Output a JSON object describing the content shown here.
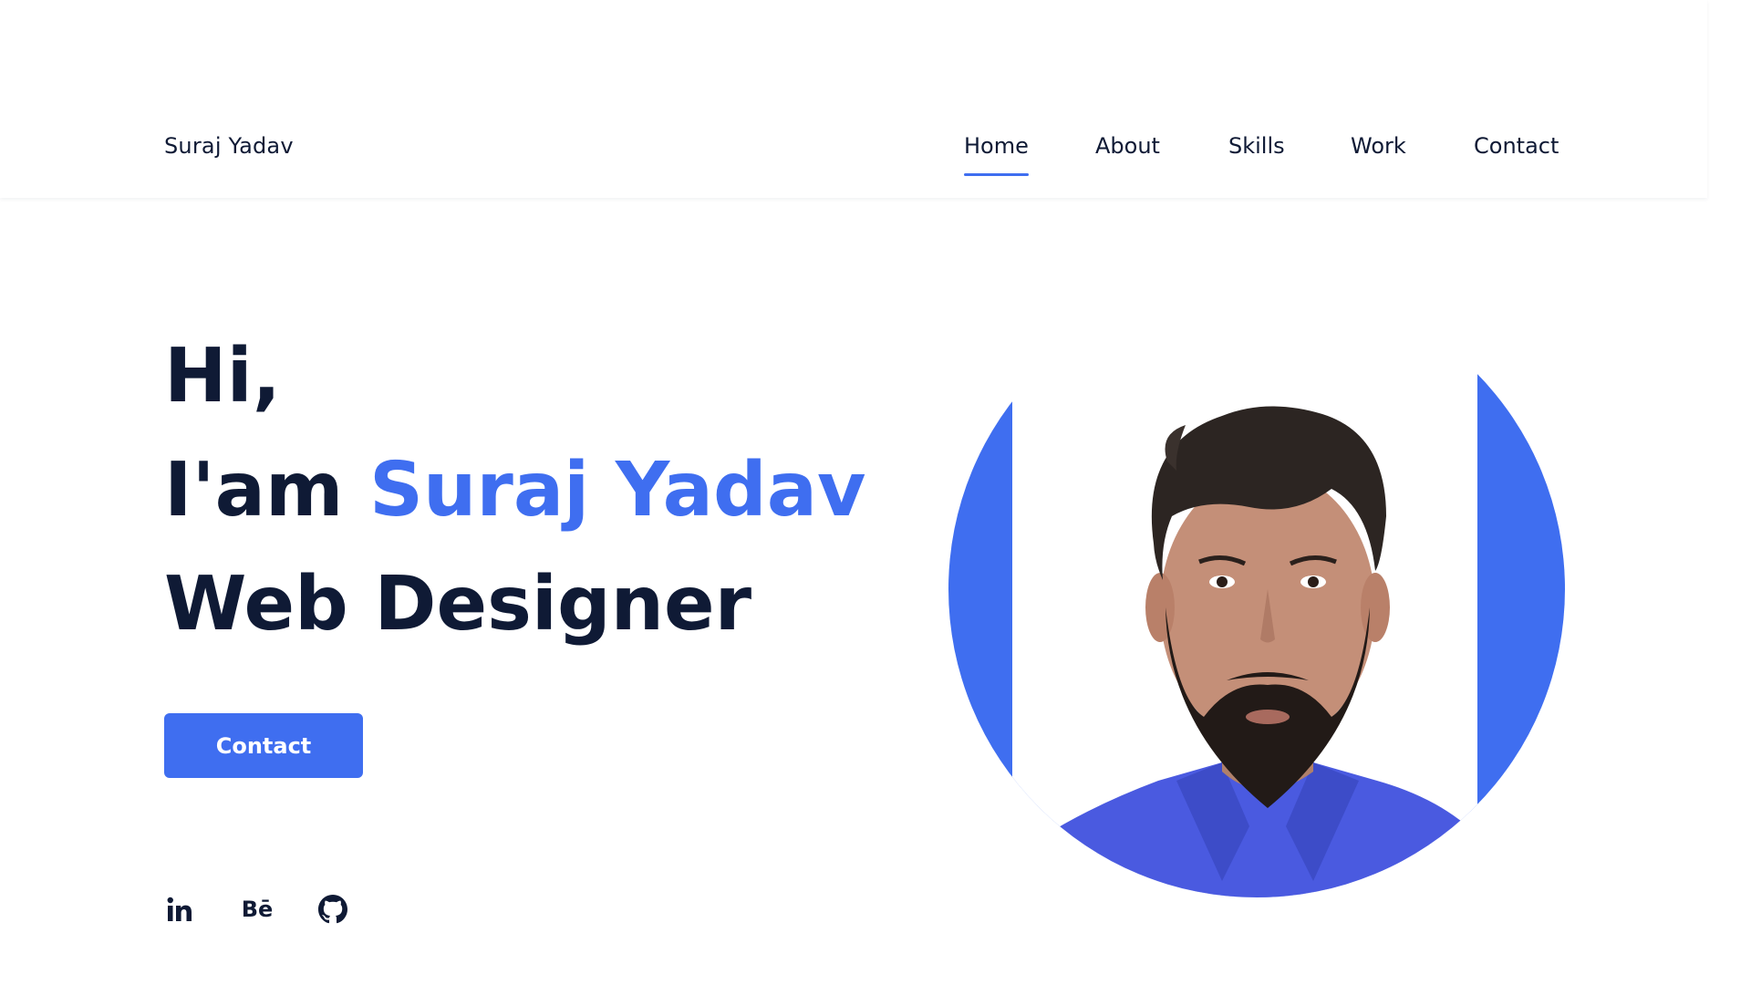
{
  "header": {
    "logo": "Suraj Yadav",
    "nav": [
      {
        "label": "Home",
        "active": true
      },
      {
        "label": "About",
        "active": false
      },
      {
        "label": "Skills",
        "active": false
      },
      {
        "label": "Work",
        "active": false
      },
      {
        "label": "Contact",
        "active": false
      }
    ]
  },
  "hero": {
    "greeting": "Hi,",
    "intro_prefix": "I'am ",
    "name": "Suraj Yadav",
    "role": "Web Designer",
    "button_label": "Contact"
  },
  "social": [
    {
      "icon": "linkedin-icon",
      "text": "in"
    },
    {
      "icon": "behance-icon",
      "text": "Bē"
    },
    {
      "icon": "github-icon",
      "text": ""
    }
  ],
  "colors": {
    "accent": "#3f6ef0",
    "text": "#0f1a35",
    "background": "#ffffff"
  }
}
